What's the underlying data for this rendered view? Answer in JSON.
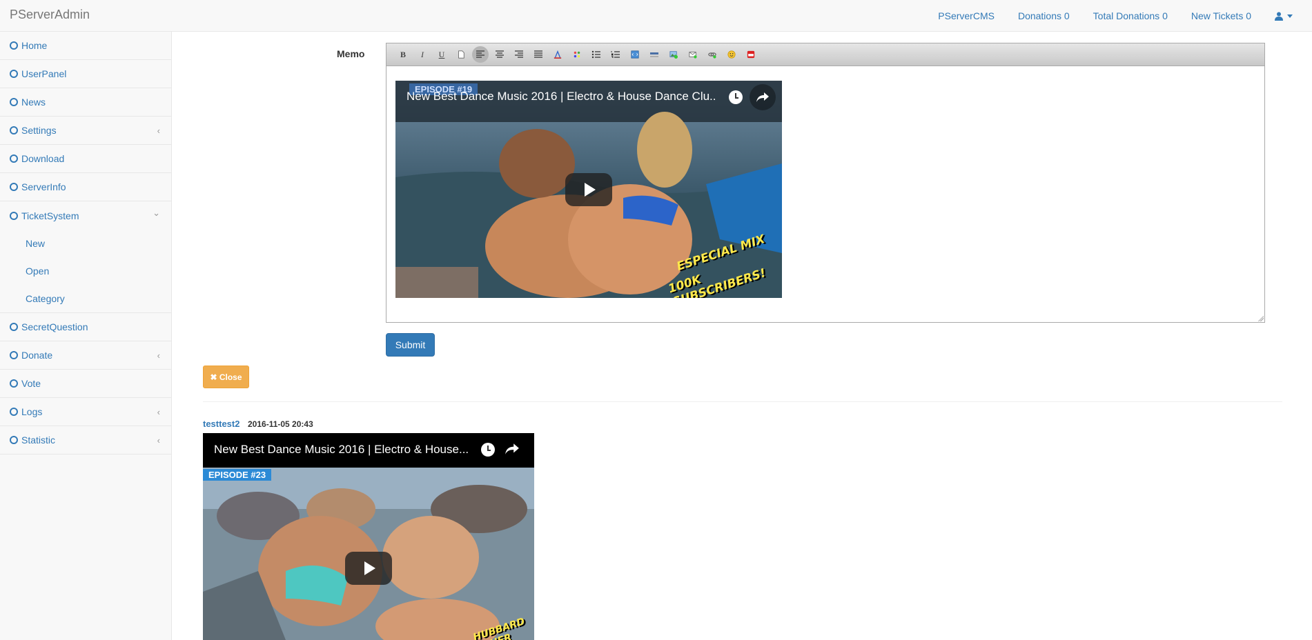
{
  "navbar": {
    "brand": "PServerAdmin",
    "links": [
      {
        "label": "PServerCMS"
      },
      {
        "label": "Donations 0"
      },
      {
        "label": "Total Donations 0"
      },
      {
        "label": "New Tickets 0"
      }
    ],
    "user_icon": "user-icon"
  },
  "sidebar": {
    "items": [
      {
        "label": "Home"
      },
      {
        "label": "UserPanel"
      },
      {
        "label": "News"
      },
      {
        "label": "Settings",
        "chevron": "‹"
      },
      {
        "label": "Download"
      },
      {
        "label": "ServerInfo"
      },
      {
        "label": "TicketSystem",
        "chevron": "⌄"
      },
      {
        "label": "SecretQuestion"
      },
      {
        "label": "Donate",
        "chevron": "‹"
      },
      {
        "label": "Vote"
      },
      {
        "label": "Logs",
        "chevron": "‹"
      },
      {
        "label": "Statistic",
        "chevron": "‹"
      }
    ],
    "ticket_subitems": [
      {
        "label": "New"
      },
      {
        "label": "Open"
      },
      {
        "label": "Category"
      }
    ]
  },
  "form": {
    "memo_label": "Memo",
    "toolbar_buttons": [
      "bold",
      "italic",
      "underline",
      "new-document",
      "align-left",
      "align-center",
      "align-right",
      "justify",
      "font-color",
      "background-color",
      "unordered-list",
      "ordered-list",
      "html-source",
      "horizontal-rule",
      "insert-image",
      "insert-email",
      "insert-link",
      "insert-emoticon",
      "insert-youtube"
    ],
    "toolbar_labels": {
      "bold": "B",
      "italic": "I",
      "underline": "U"
    },
    "submit_label": "Submit",
    "close_label": "✖ Close"
  },
  "editor_video": {
    "title": "New Best Dance Music 2016 | Electro & House Dance Clu..",
    "episode": "EPISODE #19",
    "overlay_line1": "ESPECIAL MIX",
    "overlay_line2": "100K SUBSCRIBERS!"
  },
  "post": {
    "author": "testtest2",
    "date": "2016-11-05 20:43",
    "video": {
      "title": "New Best Dance Music 2016 | Electro & House...",
      "episode": "EPISODE #23",
      "overlay_text": "HUBBARD IS HER PART"
    }
  }
}
